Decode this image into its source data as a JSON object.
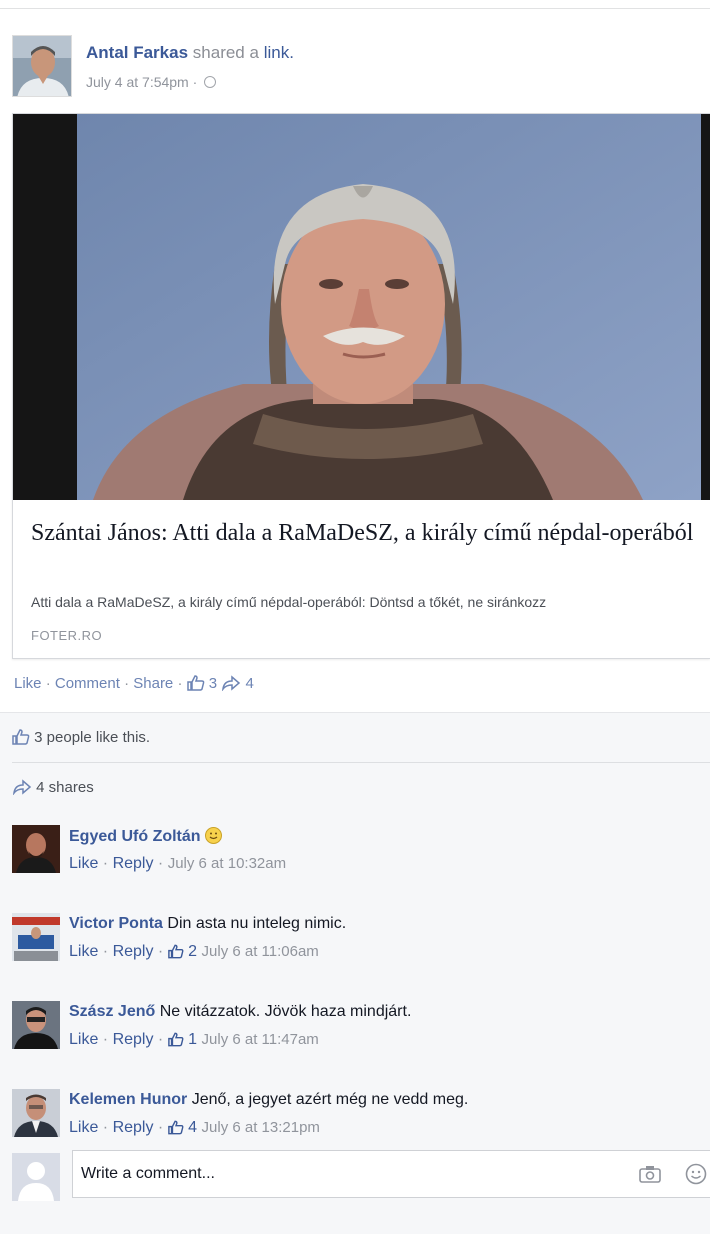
{
  "post": {
    "author": "Antal Farkas",
    "shared_text": "shared a",
    "link_word": "link.",
    "timestamp": "July 4 at 7:54pm ·"
  },
  "link": {
    "title": "Szántai János: Atti dala a RaMaDeSZ, a király című népdal-operából",
    "description": "Atti dala a RaMaDeSZ, a király című népdal-operából: Döntsd a tőkét, ne siránkozz",
    "domain": "FOTER.RO"
  },
  "actions": {
    "like": "Like",
    "comment": "Comment",
    "share": "Share",
    "like_count": "3",
    "share_count": "4"
  },
  "feedback": {
    "likes_text": "3 people like this.",
    "shares_text": "4 shares"
  },
  "comments": [
    {
      "name": "Egyed Ufó Zoltán",
      "text": "",
      "like": "Like",
      "reply": "Reply",
      "likes": "",
      "time": "July 6 at 10:32am"
    },
    {
      "name": "Victor Ponta",
      "text": "Din asta nu inteleg nimic.",
      "like": "Like",
      "reply": "Reply",
      "likes": "2",
      "time": "July 6 at 11:06am"
    },
    {
      "name": "Szász Jenő",
      "text": "Ne vitázzatok. Jövök haza mindjárt.",
      "like": "Like",
      "reply": "Reply",
      "likes": "1",
      "time": "July 6 at 11:47am"
    },
    {
      "name": "Kelemen Hunor",
      "text": "Jenő, a jegyet azért még ne vedd meg.",
      "like": "Like",
      "reply": "Reply",
      "likes": "4",
      "time": "July 6 at 13:21pm"
    }
  ],
  "composer": {
    "placeholder": "Write a comment..."
  },
  "icons": {
    "like": "thumbs-up-icon",
    "share": "share-arrow-icon",
    "privacy": "globe-icon",
    "camera": "camera-icon",
    "emoji": "smiley-icon"
  },
  "colors": {
    "link_blue": "#3b5998",
    "muted_gray": "#90949c",
    "feedback_bg": "#f6f7f9"
  }
}
